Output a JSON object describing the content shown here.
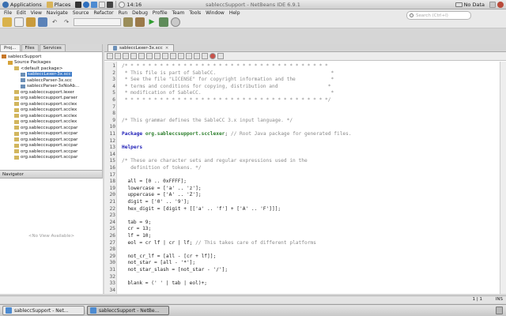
{
  "top_panel": {
    "applications": "Applications",
    "places": "Places",
    "clock": "14:16",
    "window_title": "sableccSupport - NetBeans IDE 6.9.1",
    "battery": "No Data"
  },
  "menu": [
    "File",
    "Edit",
    "View",
    "Navigate",
    "Source",
    "Refactor",
    "Run",
    "Debug",
    "Profile",
    "Team",
    "Tools",
    "Window",
    "Help"
  ],
  "search": {
    "placeholder": "Search (Ctrl+I)"
  },
  "left_tabs": [
    "Proj...",
    "Files",
    "Services"
  ],
  "tree": [
    {
      "label": "sableccSupport",
      "indent": 2,
      "color": "#c7782a"
    },
    {
      "label": "Source Packages",
      "indent": 10,
      "color": "#d6a33a"
    },
    {
      "label": "<default package>",
      "indent": 18,
      "color": "#d2b65e"
    },
    {
      "label": "sableccLexer-3x.scc",
      "indent": 26,
      "color": "#6b8fb7",
      "selected": true
    },
    {
      "label": "sableccParser-3x.scc",
      "indent": 26,
      "color": "#6b8fb7"
    },
    {
      "label": "sableccParser-3xNoAb...",
      "indent": 26,
      "color": "#6b8fb7"
    },
    {
      "label": "org.sableccsupport.lexer",
      "indent": 18,
      "color": "#d2b65e"
    },
    {
      "label": "org.sableccsupport.parser",
      "indent": 18,
      "color": "#d2b65e"
    },
    {
      "label": "org.sableccsupport.scclex",
      "indent": 18,
      "color": "#d2b65e"
    },
    {
      "label": "org.sableccsupport.scclex",
      "indent": 18,
      "color": "#d2b65e"
    },
    {
      "label": "org.sableccsupport.scclex",
      "indent": 18,
      "color": "#d2b65e"
    },
    {
      "label": "org.sableccsupport.scclex",
      "indent": 18,
      "color": "#d2b65e"
    },
    {
      "label": "org.sableccsupport.sccpar",
      "indent": 18,
      "color": "#d2b65e"
    },
    {
      "label": "org.sableccsupport.sccpar",
      "indent": 18,
      "color": "#d2b65e"
    },
    {
      "label": "org.sableccsupport.sccpar",
      "indent": 18,
      "color": "#d2b65e"
    },
    {
      "label": "org.sableccsupport.sccpar",
      "indent": 18,
      "color": "#d2b65e"
    },
    {
      "label": "org.sableccsupport.sccpar",
      "indent": 18,
      "color": "#d2b65e"
    },
    {
      "label": "org.sableccsupport.sccpar",
      "indent": 18,
      "color": "#d2b65e"
    }
  ],
  "navigator": {
    "title": "Navigator",
    "empty": "<No View Available>"
  },
  "editor_tab": "sableccLexer-3x.scc",
  "code": [
    {
      "n": "1",
      "parts": [
        [
          "cm",
          "/* * * * * * * * * * * * * * * * * * * * * * * * * * * * * * * * * * *"
        ]
      ]
    },
    {
      "n": "2",
      "parts": [
        [
          "cm",
          " * This file is part of SableCC.                                       *"
        ]
      ]
    },
    {
      "n": "3",
      "parts": [
        [
          "cm",
          " * See the file \"LICENSE\" for copyright information and the            *"
        ]
      ]
    },
    {
      "n": "4",
      "parts": [
        [
          "cm",
          " * terms and conditions for copying, distribution and                 *"
        ]
      ]
    },
    {
      "n": "5",
      "parts": [
        [
          "cm",
          " * modification of SableCC.                                            *"
        ]
      ]
    },
    {
      "n": "6",
      "parts": [
        [
          "cm",
          " * * * * * * * * * * * * * * * * * * * * * * * * * * * * * * * * * * */"
        ]
      ]
    },
    {
      "n": "7",
      "parts": []
    },
    {
      "n": "8",
      "parts": []
    },
    {
      "n": "9",
      "parts": [
        [
          "cm",
          "/* This grammar defines the SableCC 3.x input language. */"
        ]
      ]
    },
    {
      "n": "10",
      "parts": []
    },
    {
      "n": "11",
      "parts": [
        [
          "kw",
          "Package "
        ],
        [
          "pk",
          "org.sableccsupport.scclexer"
        ],
        [
          "",
          "; "
        ],
        [
          "cm",
          "// Root Java package for generated files."
        ]
      ]
    },
    {
      "n": "12",
      "parts": []
    },
    {
      "n": "13",
      "parts": [
        [
          "kw",
          "Helpers"
        ]
      ]
    },
    {
      "n": "14",
      "parts": []
    },
    {
      "n": "15",
      "parts": [
        [
          "cm",
          "/* These are character sets and regular expressions used in the"
        ]
      ]
    },
    {
      "n": "16",
      "parts": [
        [
          "cm",
          "   definition of tokens. */"
        ]
      ]
    },
    {
      "n": "17",
      "parts": []
    },
    {
      "n": "18",
      "parts": [
        [
          "",
          "  all = [0 .. 0xFFFF];"
        ]
      ]
    },
    {
      "n": "19",
      "parts": [
        [
          "",
          "  lowercase = ['a' .. 'z'];"
        ]
      ]
    },
    {
      "n": "20",
      "parts": [
        [
          "",
          "  uppercase = ['A' .. 'Z'];"
        ]
      ]
    },
    {
      "n": "21",
      "parts": [
        [
          "",
          "  digit = ['0' .. '9'];"
        ]
      ]
    },
    {
      "n": "22",
      "parts": [
        [
          "",
          "  hex_digit = [digit + [['a' .. 'f'] + ['A' .. 'F']]];"
        ]
      ]
    },
    {
      "n": "23",
      "parts": []
    },
    {
      "n": "24",
      "parts": [
        [
          "",
          "  tab = 9;"
        ]
      ]
    },
    {
      "n": "25",
      "parts": [
        [
          "",
          "  cr = 13;"
        ]
      ]
    },
    {
      "n": "26",
      "parts": [
        [
          "",
          "  lf = 10;"
        ]
      ]
    },
    {
      "n": "27",
      "parts": [
        [
          "",
          "  eol = cr lf | cr | lf; "
        ],
        [
          "cm",
          "// This takes care of different platforms"
        ]
      ]
    },
    {
      "n": "28",
      "parts": []
    },
    {
      "n": "29",
      "parts": [
        [
          "",
          "  not_cr_lf = [all - [cr + lf]];"
        ]
      ]
    },
    {
      "n": "30",
      "parts": [
        [
          "",
          "  not_star = [all - '*'];"
        ]
      ]
    },
    {
      "n": "31",
      "parts": [
        [
          "",
          "  not_star_slash = [not_star - '/'];"
        ]
      ]
    },
    {
      "n": "32",
      "parts": []
    },
    {
      "n": "33",
      "parts": [
        [
          "",
          "  blank = (' ' | tab | eol)+;"
        ]
      ]
    },
    {
      "n": "34",
      "parts": []
    }
  ],
  "status": {
    "position": "1 | 1",
    "mode": "INS"
  },
  "taskbar": [
    "sableccSupport - Net...",
    "sableccSupport - NetBe..."
  ]
}
